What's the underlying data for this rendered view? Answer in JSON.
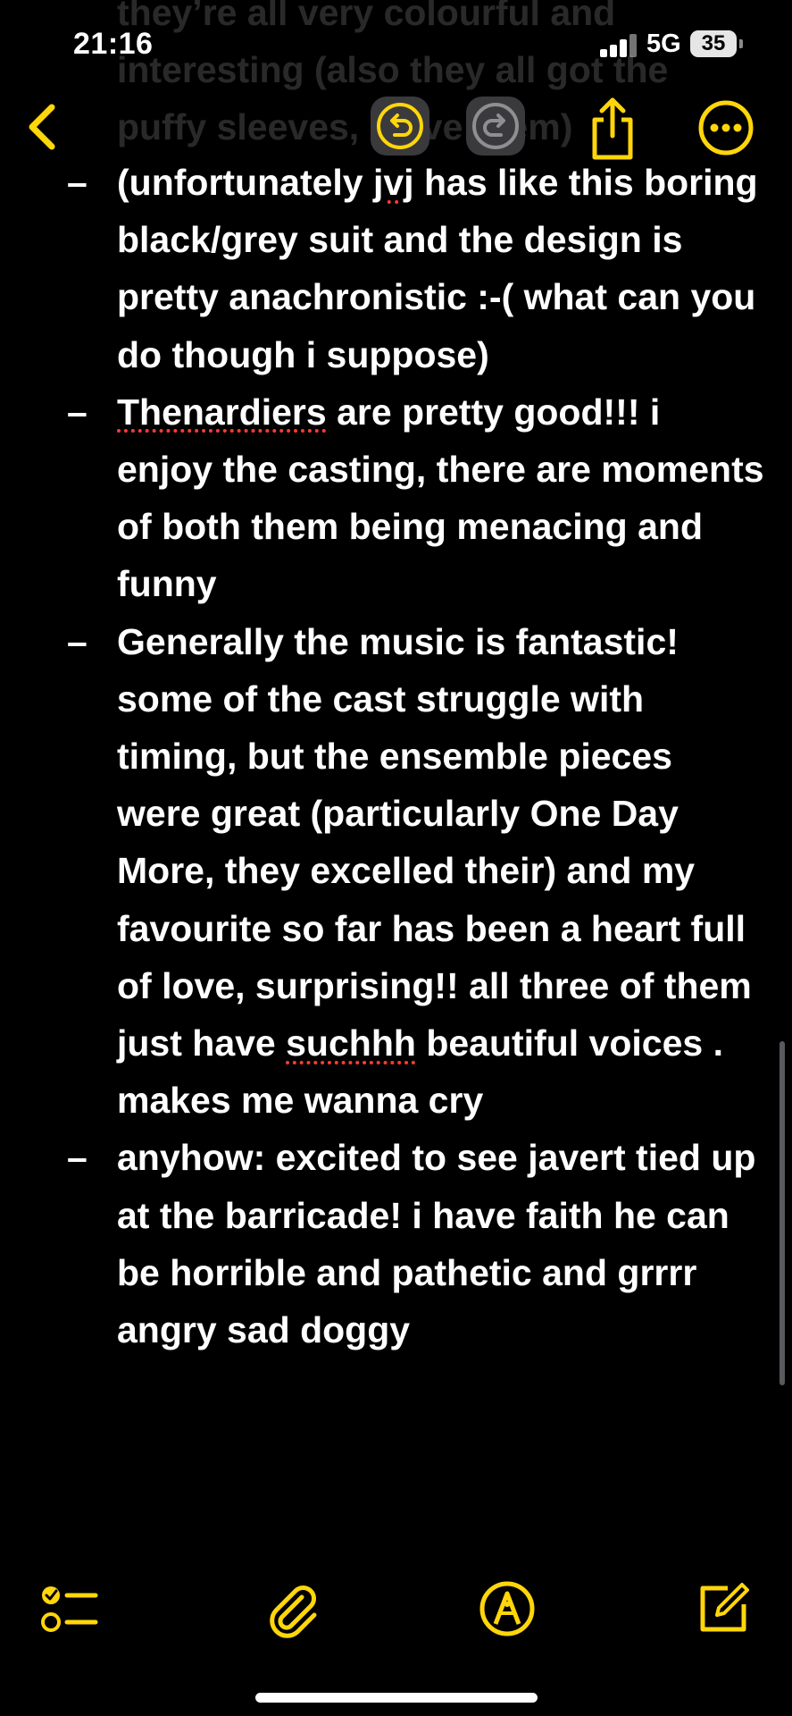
{
  "status_bar": {
    "time": "21:16",
    "network": "5G",
    "battery": "35"
  },
  "nav": {
    "back_icon": "chevron-left-icon",
    "undo_icon": "undo-icon",
    "redo_icon": "redo-icon",
    "share_icon": "share-icon",
    "more_icon": "ellipsis-circle-icon"
  },
  "behind_text": "they’re all very colourful and\ninteresting (also they all got the\npuffy sleeves, i love them)",
  "note": {
    "dash": "–",
    "items": [
      {
        "before": "(unfortunately ",
        "misspelled": "jvj",
        "after": " has like this boring black/grey suit and the design is pretty anachronistic :-( what can you do though i suppose)"
      },
      {
        "before": "",
        "misspelled": "Thenardiers",
        "after": " are pretty good!!! i enjoy the casting, there are moments of both them being menacing and funny"
      },
      {
        "before": "Generally the music is fantastic! some of the cast struggle with timing, but the ensemble pieces were great (particularly One Day More, they excelled their) and my favourite so far has been a heart full of love, surprising!! all three of them just have ",
        "misspelled": "suchhh",
        "after": " beautiful voices . makes me wanna cry"
      },
      {
        "before": "anyhow: excited to see javert tied up at the barricade! i have faith he can be horrible and pathetic and grrrr angry sad doggy",
        "misspelled": "",
        "after": ""
      }
    ]
  },
  "toolbar": {
    "checklist_icon": "checklist-icon",
    "attach_icon": "paperclip-icon",
    "markup_icon": "pen-tip-circle-icon",
    "compose_icon": "compose-icon"
  },
  "colors": {
    "accent": "#FFD60A",
    "background": "#000000",
    "text": "#FFFFFF",
    "spell_error": "#FF3B30"
  }
}
